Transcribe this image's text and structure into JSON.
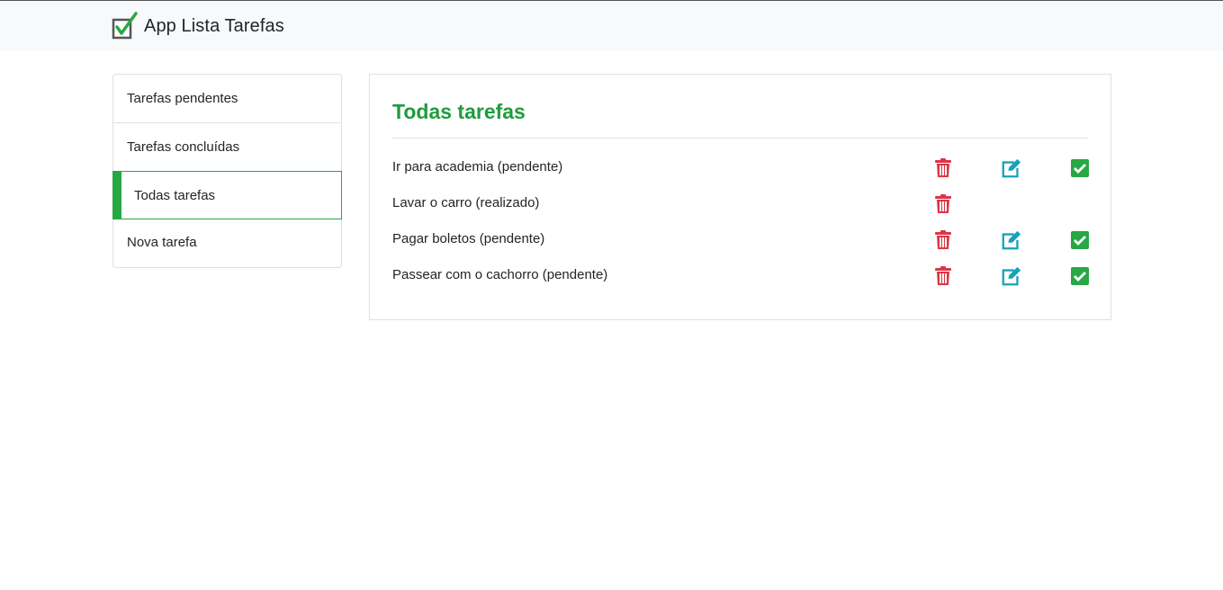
{
  "header": {
    "brand_text": "App Lista Tarefas",
    "logo_icon": "checkbox-check-logo"
  },
  "sidebar": {
    "items": [
      {
        "label": "Tarefas pendentes",
        "active": false
      },
      {
        "label": "Tarefas concluídas",
        "active": false
      },
      {
        "label": "Todas tarefas",
        "active": true
      },
      {
        "label": "Nova tarefa",
        "active": false
      }
    ]
  },
  "main": {
    "title": "Todas tarefas",
    "tasks": [
      {
        "text": "Ir para academia (pendente)",
        "actions": [
          "delete",
          "edit",
          "complete"
        ]
      },
      {
        "text": "Lavar o carro (realizado)",
        "actions": [
          "delete"
        ]
      },
      {
        "text": "Pagar boletos (pendente)",
        "actions": [
          "delete",
          "edit",
          "complete"
        ]
      },
      {
        "text": "Passear com o cachorro (pendente)",
        "actions": [
          "delete",
          "edit",
          "complete"
        ]
      }
    ]
  },
  "colors": {
    "accent": "#28a745",
    "title": "#1e9c3c",
    "delete": "#dc3545",
    "edit": "#17a2b8",
    "complete": "#28a745"
  },
  "icons": {
    "delete": "trash-icon",
    "edit": "edit-icon",
    "complete": "check-square-icon"
  }
}
